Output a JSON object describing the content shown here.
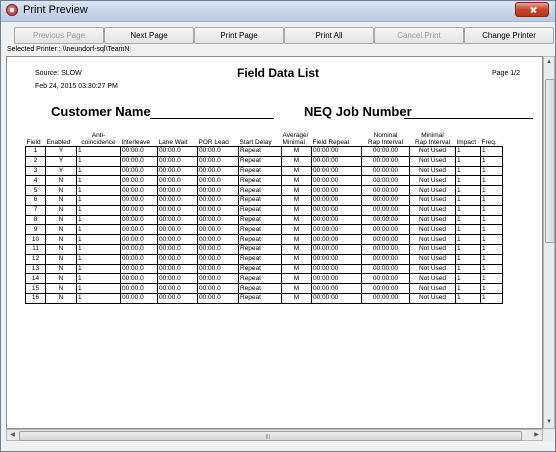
{
  "window": {
    "title": "Print Preview"
  },
  "toolbar": {
    "previous_page": "Previous Page",
    "next_page": "Next Page",
    "print_page": "Print Page",
    "print_all": "Print All",
    "cancel_print": "Cancel Print",
    "change_printer": "Change Printer"
  },
  "selected_printer": "Selected Printer : \\\\neundorf-sql\\TeamN",
  "report": {
    "source": "Source: SLOW",
    "date": "Feb 24, 2015 03:30:27 PM",
    "title": "Field Data List",
    "page": "Page 1/2",
    "customer_name_label": "Customer Name",
    "job_number_label": "NEQ Job Number"
  },
  "table": {
    "headers": [
      "Field",
      "Enabled",
      "Anti-\ncoincidence",
      "Interleave",
      "Lane Wait",
      "POR Lead",
      "Start Delay",
      "Average/\nMinimal",
      "Field Repeat",
      "Nominal\nRap Interval",
      "Minimal\nRap Interval",
      "Impact",
      "Freq."
    ],
    "rows": [
      [
        "1",
        "Y",
        "1",
        "00:00.0",
        "00:00.0",
        "00:00.0",
        "Repeat",
        "M",
        "00:00:00",
        "00:00:00",
        "Not Used",
        "1",
        "1"
      ],
      [
        "2",
        "Y",
        "1",
        "00:00.0",
        "00:00.0",
        "00:00.0",
        "Repeat",
        "M",
        "00:00:00",
        "00:00:00",
        "Not Used",
        "1",
        "1"
      ],
      [
        "3",
        "Y",
        "1",
        "00:00.0",
        "00:00.0",
        "00:00.0",
        "Repeat",
        "M",
        "00:00:00",
        "00:00:00",
        "Not Used",
        "1",
        "1"
      ],
      [
        "4",
        "N",
        "1",
        "00:00.0",
        "00:00.0",
        "00:00.0",
        "Repeat",
        "M",
        "00:00:00",
        "00:00:00",
        "Not Used",
        "1",
        "1"
      ],
      [
        "5",
        "N",
        "1",
        "00:00.0",
        "00:00.0",
        "00:00.0",
        "Repeat",
        "M",
        "00:00:00",
        "00:00:00",
        "Not Used",
        "1",
        "1"
      ],
      [
        "6",
        "N",
        "1",
        "00:00.0",
        "00:00.0",
        "00:00.0",
        "Repeat",
        "M",
        "00:00:00",
        "00:00:00",
        "Not Used",
        "1",
        "1"
      ],
      [
        "7",
        "N",
        "1",
        "00:00.0",
        "00:00.0",
        "00:00.0",
        "Repeat",
        "M",
        "00:00:00",
        "00:00:00",
        "Not Used",
        "1",
        "1"
      ],
      [
        "8",
        "N",
        "1",
        "00:00.0",
        "00:00.0",
        "00:00.0",
        "Repeat",
        "M",
        "00:00:00",
        "00:00:00",
        "Not Used",
        "1",
        "1"
      ],
      [
        "9",
        "N",
        "1",
        "00:00.0",
        "00:00.0",
        "00:00.0",
        "Repeat",
        "M",
        "00:00:00",
        "00:00:00",
        "Not Used",
        "1",
        "1"
      ],
      [
        "10",
        "N",
        "1",
        "00:00.0",
        "00:00.0",
        "00:00.0",
        "Repeat",
        "M",
        "00:00:00",
        "00:00:00",
        "Not Used",
        "1",
        "1"
      ],
      [
        "11",
        "N",
        "1",
        "00:00.0",
        "00:00.0",
        "00:00.0",
        "Repeat",
        "M",
        "00:00:00",
        "00:00:00",
        "Not Used",
        "1",
        "1"
      ],
      [
        "12",
        "N",
        "1",
        "00:00.0",
        "00:00.0",
        "00:00.0",
        "Repeat",
        "M",
        "00:00:00",
        "00:00:00",
        "Not Used",
        "1",
        "1"
      ],
      [
        "13",
        "N",
        "1",
        "00:00.0",
        "00:00.0",
        "00:00.0",
        "Repeat",
        "M",
        "00:00:00",
        "00:00:00",
        "Not Used",
        "1",
        "1"
      ],
      [
        "14",
        "N",
        "1",
        "00:00.0",
        "00:00.0",
        "00:00.0",
        "Repeat",
        "M",
        "00:00:00",
        "00:00:00",
        "Not Used",
        "1",
        "1"
      ],
      [
        "15",
        "N",
        "1",
        "00:00.0",
        "00:00.0",
        "00:00.0",
        "Repeat",
        "M",
        "00:00:00",
        "00:00:00",
        "Not Used",
        "1",
        "1"
      ],
      [
        "16",
        "N",
        "1",
        "00:00.0",
        "00:00.0",
        "00:00.0",
        "Repeat",
        "M",
        "00:00:00",
        "00:00:00",
        "Not Used",
        "1",
        "1"
      ]
    ]
  },
  "scrollbar_icons": {
    "up": "arrow-up-icon",
    "down": "arrow-down-icon",
    "left": "arrow-left-icon",
    "right": "arrow-right-icon"
  }
}
